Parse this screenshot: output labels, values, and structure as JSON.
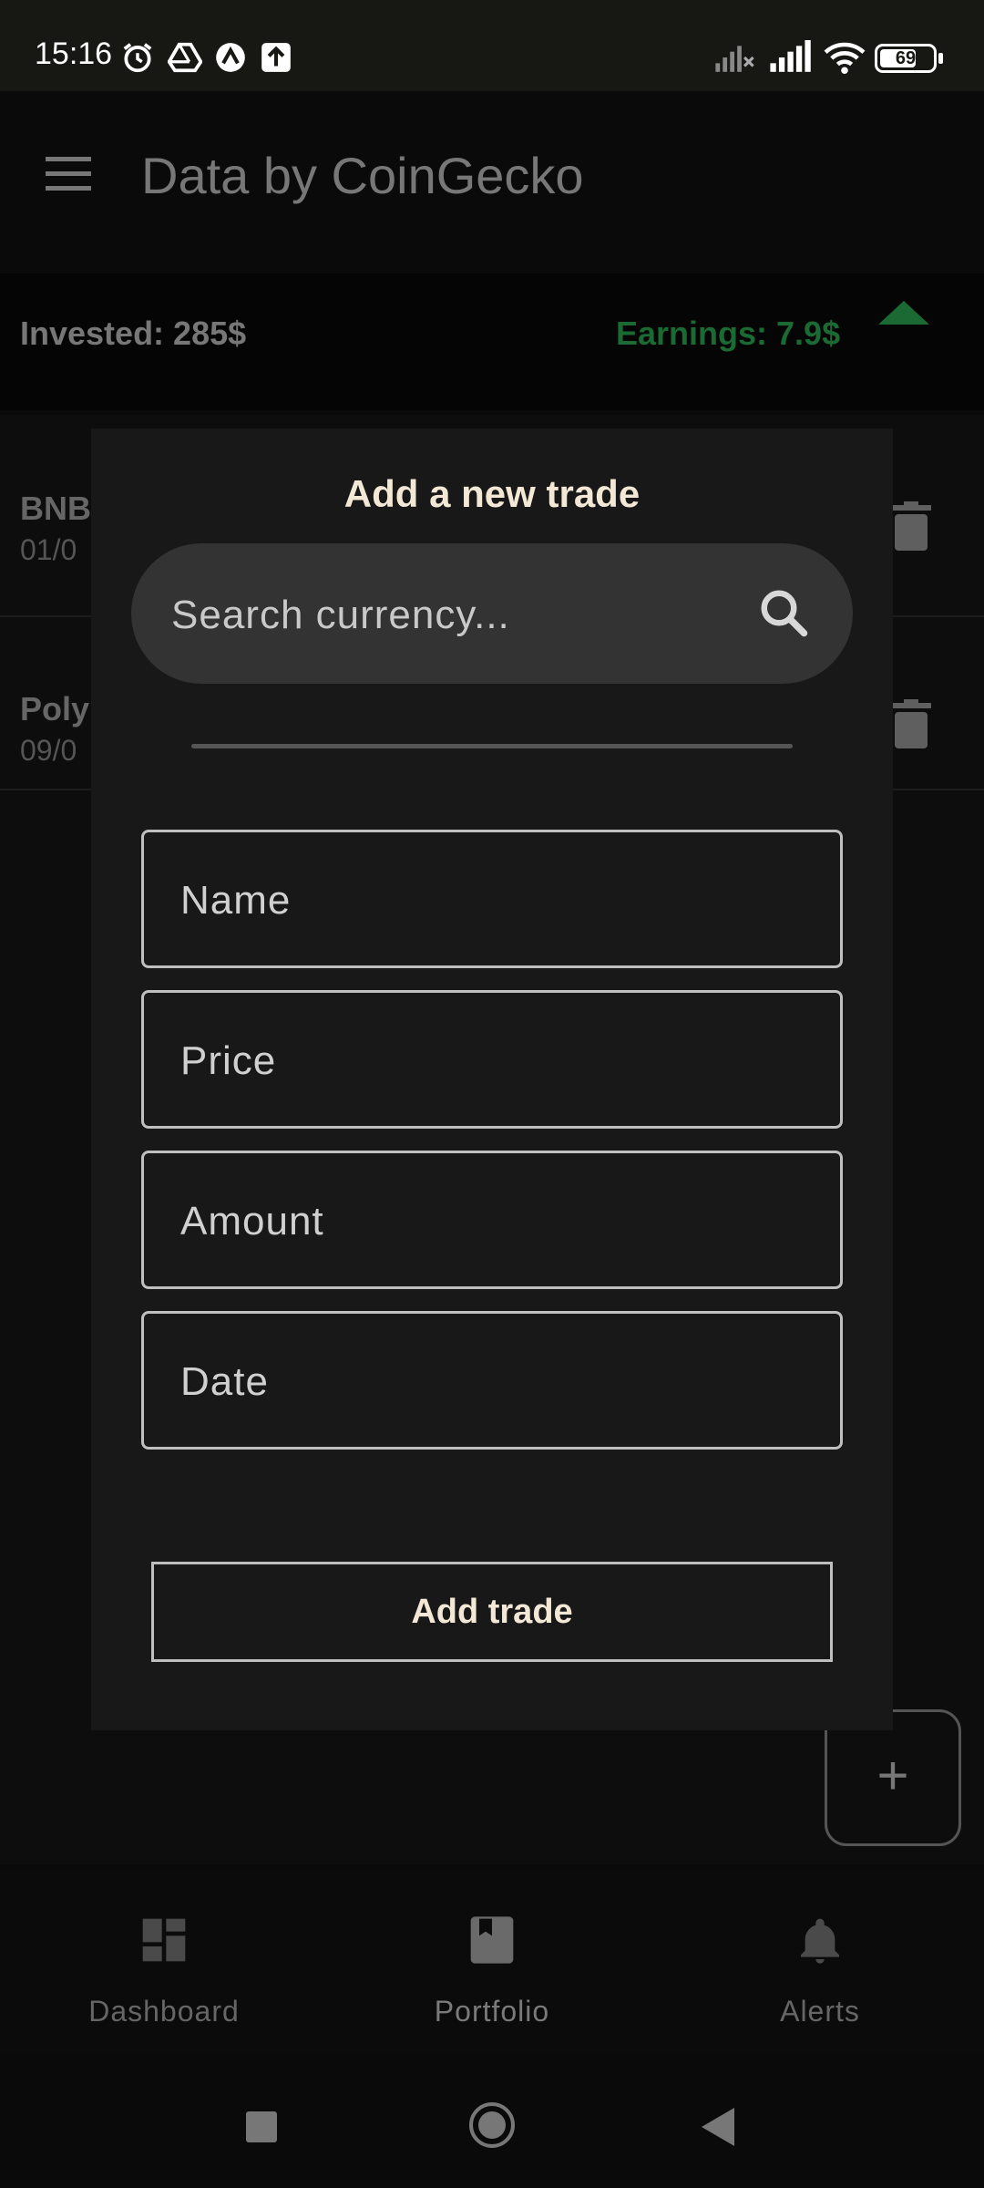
{
  "status_bar": {
    "time": "15:16",
    "battery": "69",
    "battery_level": 0.69
  },
  "app_bar": {
    "title": "Data by CoinGecko"
  },
  "summary": {
    "invested": "Invested: 285$",
    "earnings": "Earnings: 7.9$",
    "earnings_trend": "up",
    "earnings_color": "#1b6a33"
  },
  "trades": [
    {
      "name": "BNB",
      "date": "01/0"
    },
    {
      "name": "Poly",
      "date": "09/0"
    }
  ],
  "dialog": {
    "title": "Add a new trade",
    "search_placeholder": "Search currency...",
    "fields": {
      "name_placeholder": "Name",
      "price_placeholder": "Price",
      "amount_placeholder": "Amount",
      "date_placeholder": "Date"
    },
    "submit_label": "Add trade"
  },
  "fab": {
    "label": "+"
  },
  "bottom_nav": {
    "items": [
      {
        "label": "Dashboard",
        "icon": "dashboard-icon"
      },
      {
        "label": "Portfolio",
        "icon": "bookmark-book-icon",
        "selected": true
      },
      {
        "label": "Alerts",
        "icon": "bell-icon"
      }
    ]
  }
}
